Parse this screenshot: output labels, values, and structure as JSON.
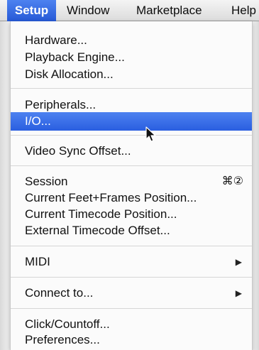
{
  "menubar": {
    "items": [
      {
        "label": "Setup"
      },
      {
        "label": "Window"
      },
      {
        "label": "Marketplace"
      },
      {
        "label": "Help"
      }
    ]
  },
  "menu": {
    "hardware": "Hardware...",
    "playback_engine": "Playback Engine...",
    "disk_allocation": "Disk Allocation...",
    "peripherals": "Peripherals...",
    "io": "I/O...",
    "video_sync_offset": "Video Sync Offset...",
    "session": "Session",
    "session_shortcut": "⌘②",
    "current_feet_frames": "Current Feet+Frames Position...",
    "current_timecode": "Current Timecode Position...",
    "external_timecode": "External Timecode Offset...",
    "midi": "MIDI",
    "connect_to": "Connect to...",
    "click_countoff": "Click/Countoff...",
    "preferences": "Preferences...",
    "submenu_arrow": "▶"
  },
  "colors": {
    "highlight": "#2f63e3"
  },
  "icons": {
    "cursor": "mouse-pointer-icon"
  }
}
